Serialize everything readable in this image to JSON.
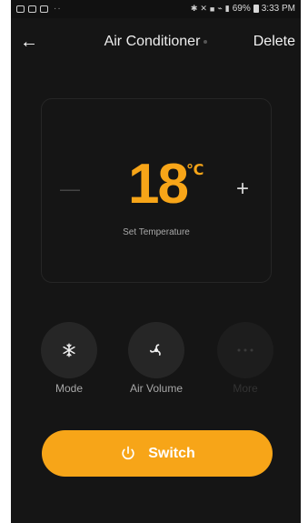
{
  "status_bar": {
    "left_dots": "··",
    "right_text": "69%",
    "time": "3:33 PM"
  },
  "header": {
    "title": "Air Conditioner",
    "delete_label": "Delete"
  },
  "temperature": {
    "value": "18",
    "unit": "℃",
    "label": "Set Temperature",
    "minus_icon": "minus-icon",
    "plus_icon": "plus-icon"
  },
  "controls": [
    {
      "name": "Mode",
      "icon": "snowflake-icon",
      "enabled": true
    },
    {
      "name": "Air Volume",
      "icon": "fan-icon",
      "enabled": true
    },
    {
      "name": "More",
      "icon": "more-icon",
      "enabled": false
    }
  ],
  "switch": {
    "label": "Switch",
    "icon": "power-icon",
    "color": "#f7a518"
  },
  "colors": {
    "accent": "#f7a518",
    "background": "#151515"
  }
}
